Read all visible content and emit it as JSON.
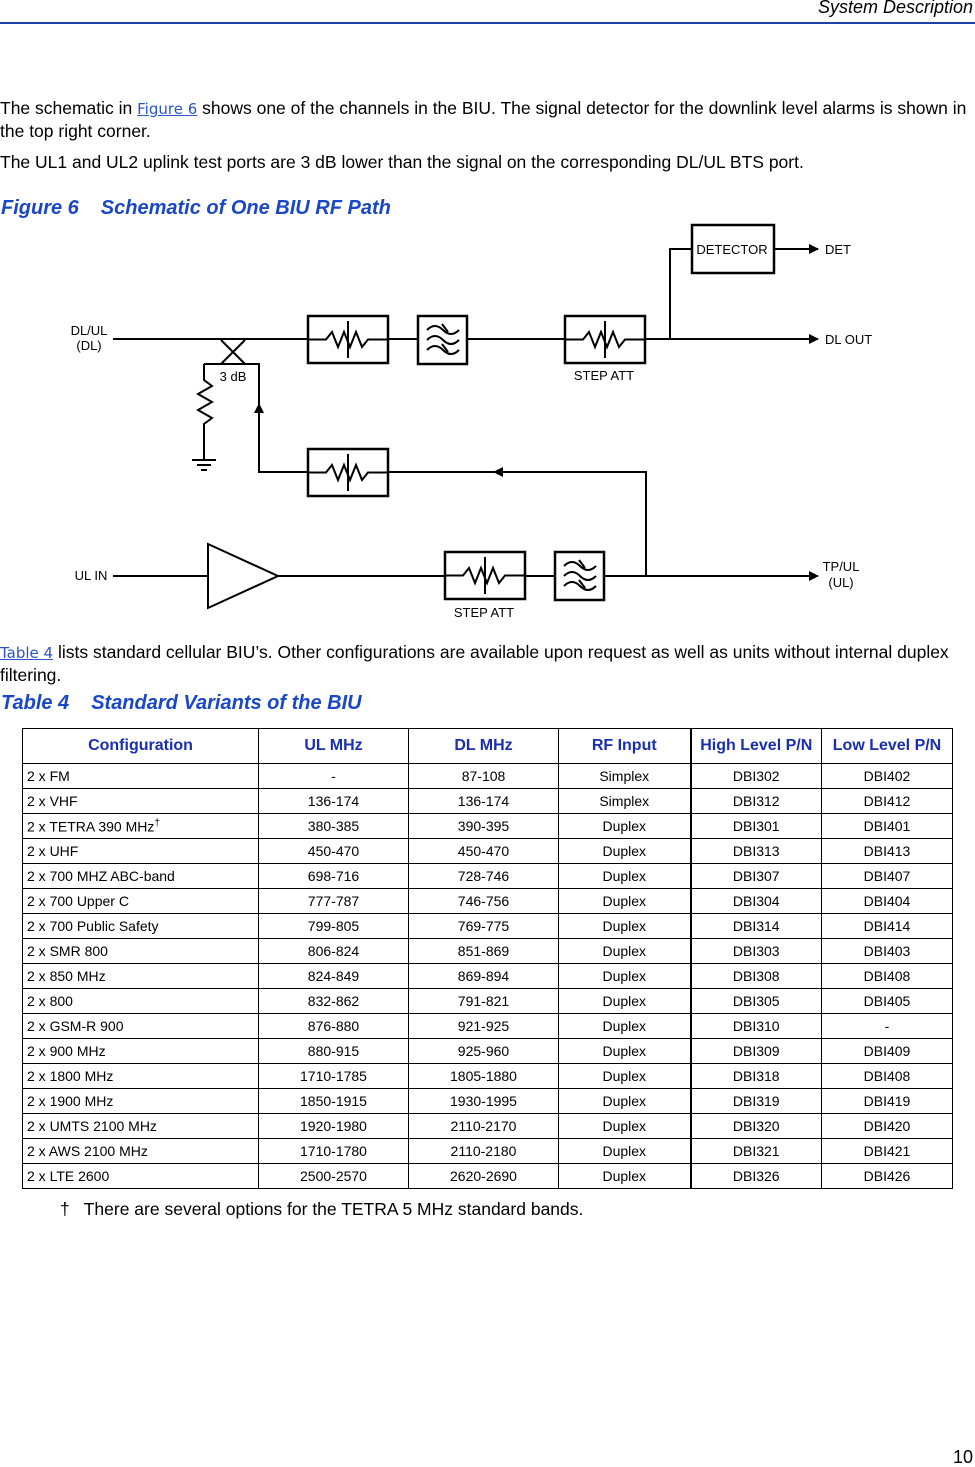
{
  "header": {
    "section": "System Description"
  },
  "body": {
    "p1_pre": "The schematic in ",
    "p1_link": "Figure 6",
    "p1_post": " shows one of the channels in the BIU. The signal detector for the downlink level alarms is shown in the top right corner.",
    "p2": "The UL1 and UL2 uplink test ports are 3 dB lower than the signal on the corresponding DL/UL BTS port.",
    "p3_link": "Table 4",
    "p3_post": " lists standard cellular BIU’s. Other configurations are available upon request as well as units without internal duplex filtering."
  },
  "figure": {
    "number": "Figure 6",
    "title": "Schematic of One BIU RF Path",
    "labels": {
      "dlul": "DL/UL",
      "dl": "(DL)",
      "coupler": "3 dB",
      "detector": "DETECTOR",
      "det": "DET",
      "dl_out": "DL OUT",
      "step_att_top": "STEP ATT",
      "ul_in": "UL IN",
      "step_att_bottom": "STEP ATT",
      "tpul": "TP/UL",
      "ul": "(UL)"
    }
  },
  "table": {
    "number": "Table 4",
    "title": "Standard Variants of the BIU",
    "columns": [
      "Configuration",
      "UL MHz",
      "DL MHz",
      "RF Input",
      "High Level P/N",
      "Low Level P/N"
    ],
    "rows": [
      [
        "2 x FM",
        "-",
        "87-108",
        "Simplex",
        "DBI302",
        "DBI402"
      ],
      [
        "2 x VHF",
        "136-174",
        "136-174",
        "Simplex",
        "DBI312",
        "DBI412"
      ],
      [
        "2 x TETRA 390 MHz†",
        "380-385",
        "390-395",
        "Duplex",
        "DBI301",
        "DBI401"
      ],
      [
        "2 x UHF",
        "450-470",
        "450-470",
        "Duplex",
        "DBI313",
        "DBI413"
      ],
      [
        "2 x 700 MHZ ABC-band",
        "698-716",
        "728-746",
        "Duplex",
        "DBI307",
        "DBI407"
      ],
      [
        "2 x 700 Upper C",
        "777-787",
        "746-756",
        "Duplex",
        "DBI304",
        "DBI404"
      ],
      [
        "2 x 700 Public Safety",
        "799-805",
        "769-775",
        "Duplex",
        "DBI314",
        "DBI414"
      ],
      [
        "2 x SMR 800",
        "806-824",
        "851-869",
        "Duplex",
        "DBI303",
        "DBI403"
      ],
      [
        "2 x 850 MHz",
        "824-849",
        "869-894",
        "Duplex",
        "DBI308",
        "DBI408"
      ],
      [
        "2 x 800",
        "832-862",
        "791-821",
        "Duplex",
        "DBI305",
        "DBI405"
      ],
      [
        "2 x GSM-R 900",
        "876-880",
        "921-925",
        "Duplex",
        "DBI310",
        "-"
      ],
      [
        "2 x 900 MHz",
        "880-915",
        "925-960",
        "Duplex",
        "DBI309",
        "DBI409"
      ],
      [
        "2 x 1800 MHz",
        "1710-1785",
        "1805-1880",
        "Duplex",
        "DBI318",
        "DBI408"
      ],
      [
        "2 x 1900 MHz",
        "1850-1915",
        "1930-1995",
        "Duplex",
        "DBI319",
        "DBI419"
      ],
      [
        "2 x UMTS 2100 MHz",
        "1920-1980",
        "2110-2170",
        "Duplex",
        "DBI320",
        "DBI420"
      ],
      [
        "2 x AWS 2100 MHz",
        "1710-1780",
        "2110-2180",
        "Duplex",
        "DBI321",
        "DBI421"
      ],
      [
        "2 x LTE 2600",
        "2500-2570",
        "2620-2690",
        "Duplex",
        "DBI326",
        "DBI426"
      ]
    ],
    "footnote_mark": "†",
    "footnote": "There are several options for the TETRA 5 MHz standard bands."
  },
  "page_number": "10"
}
